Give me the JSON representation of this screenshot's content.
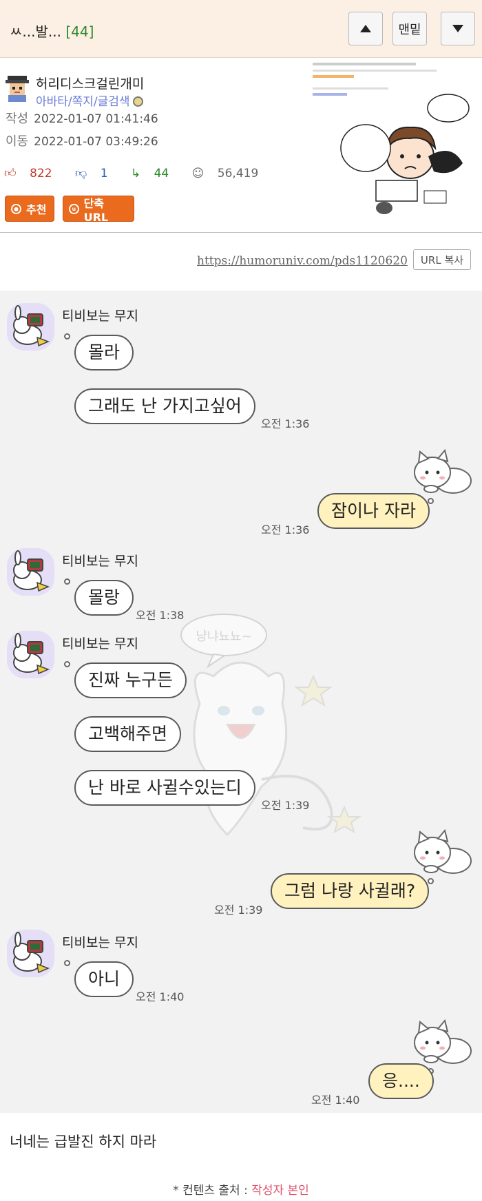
{
  "header": {
    "title": "ㅆ...발...",
    "reply_count": "[44]",
    "btn_bottom": "맨밑"
  },
  "author": {
    "nickname": "허리디스크걸린개미",
    "links": "아바타/쪽지/글검색",
    "written_label": "작성",
    "written_at": "2022-01-07 01:41:46",
    "moved_label": "이동",
    "moved_at": "2022-01-07 03:49:26",
    "upvotes": "822",
    "downvotes": "1",
    "replies": "44",
    "views": "56,419",
    "recommend_label": "추천",
    "short_url_label": "단축URL"
  },
  "url": {
    "link": "https://humoruniv.com/pds1120620",
    "copy_label": "URL 복사"
  },
  "chat": {
    "other_name": "티비보는 무지",
    "messages": [
      {
        "text": "몰라"
      },
      {
        "text": "그래도 난 가지고싶어",
        "time": "오전 1:36"
      },
      {
        "text": "잠이나 자라",
        "time": "오전 1:36"
      },
      {
        "text": "몰랑",
        "time": "오전 1:38"
      },
      {
        "text": "진짜 누구든"
      },
      {
        "text": "고백해주면"
      },
      {
        "text": "난 바로 사귈수있는디",
        "time": "오전 1:39"
      },
      {
        "text": "그럼 나랑 사귈래?",
        "time": "오전 1:39"
      },
      {
        "text": "아니",
        "time": "오전 1:40"
      },
      {
        "text": "응....",
        "time": "오전 1:40"
      }
    ],
    "watermark_text": "냥냐뇨뇨~"
  },
  "footer": {
    "body_text": "너네는 급발진 하지 마라",
    "source_prefix": "* 컨텐츠 출처 : ",
    "source_value": "작성자 본인"
  },
  "colors": {
    "header_bg": "#fcefe4",
    "orange_button": "#ea6a1e",
    "chat_bg": "#f2f2f2",
    "my_bubble": "#fff2bf",
    "link_purple": "#6b7bd8",
    "reply_green": "#2a8a2a"
  }
}
